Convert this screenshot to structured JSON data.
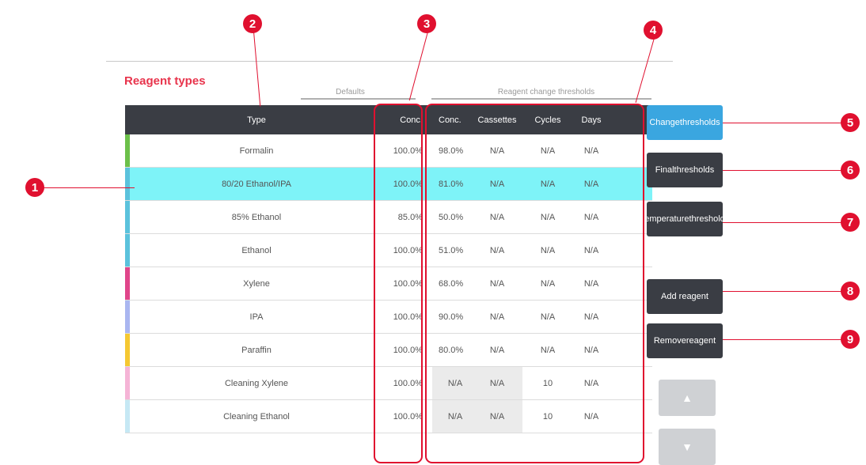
{
  "title": "Reagent types",
  "groups": {
    "defaults": "Defaults",
    "thresholds": "Reagent change thresholds"
  },
  "headers": {
    "type": "Type",
    "conc": "Conc.",
    "rc_conc": "Conc.",
    "cassettes": "Cassettes",
    "cycles": "Cycles",
    "days": "Days"
  },
  "rows": [
    {
      "type": "Formalin",
      "conc": "100.0%",
      "rc_conc": "98.0%",
      "cassettes": "N/A",
      "cycles": "N/A",
      "days": "N/A",
      "color": "#6cc04a",
      "selected": false,
      "shaded": false
    },
    {
      "type": "80/20 Ethanol/IPA",
      "conc": "100.0%",
      "rc_conc": "81.0%",
      "cassettes": "N/A",
      "cycles": "N/A",
      "days": "N/A",
      "color": "#5bc2dc",
      "selected": true,
      "shaded": false
    },
    {
      "type": "85% Ethanol",
      "conc": "85.0%",
      "rc_conc": "50.0%",
      "cassettes": "N/A",
      "cycles": "N/A",
      "days": "N/A",
      "color": "#5bc2dc",
      "selected": false,
      "shaded": false
    },
    {
      "type": "Ethanol",
      "conc": "100.0%",
      "rc_conc": "51.0%",
      "cassettes": "N/A",
      "cycles": "N/A",
      "days": "N/A",
      "color": "#5bc2dc",
      "selected": false,
      "shaded": false
    },
    {
      "type": "Xylene",
      "conc": "100.0%",
      "rc_conc": "68.0%",
      "cassettes": "N/A",
      "cycles": "N/A",
      "days": "N/A",
      "color": "#e0458a",
      "selected": false,
      "shaded": false
    },
    {
      "type": "IPA",
      "conc": "100.0%",
      "rc_conc": "90.0%",
      "cassettes": "N/A",
      "cycles": "N/A",
      "days": "N/A",
      "color": "#aab6f0",
      "selected": false,
      "shaded": false
    },
    {
      "type": "Paraffin",
      "conc": "100.0%",
      "rc_conc": "80.0%",
      "cassettes": "N/A",
      "cycles": "N/A",
      "days": "N/A",
      "color": "#f5c832",
      "selected": false,
      "shaded": false
    },
    {
      "type": "Cleaning Xylene",
      "conc": "100.0%",
      "rc_conc": "N/A",
      "cassettes": "N/A",
      "cycles": "10",
      "days": "N/A",
      "color": "#f5b4d6",
      "selected": false,
      "shaded": true
    },
    {
      "type": "Cleaning Ethanol",
      "conc": "100.0%",
      "rc_conc": "N/A",
      "cassettes": "N/A",
      "cycles": "10",
      "days": "N/A",
      "color": "#c6e8f4",
      "selected": false,
      "shaded": true
    }
  ],
  "buttons": {
    "change_thresholds": [
      "Change",
      "thresholds"
    ],
    "final_thresholds": [
      "Final",
      "thresholds"
    ],
    "temperature_thresholds": [
      "Temperature",
      "thresholds"
    ],
    "add_reagent": [
      "Add reagent"
    ],
    "remove_reagent": [
      "Remove",
      "reagent"
    ]
  },
  "callouts": [
    "1",
    "2",
    "3",
    "4",
    "5",
    "6",
    "7",
    "8",
    "9"
  ],
  "colors": {
    "accent": "#e0102f",
    "header_bg": "#3a3d44",
    "selected_row": "#7ef3f8",
    "active_button": "#3aa6e0"
  }
}
